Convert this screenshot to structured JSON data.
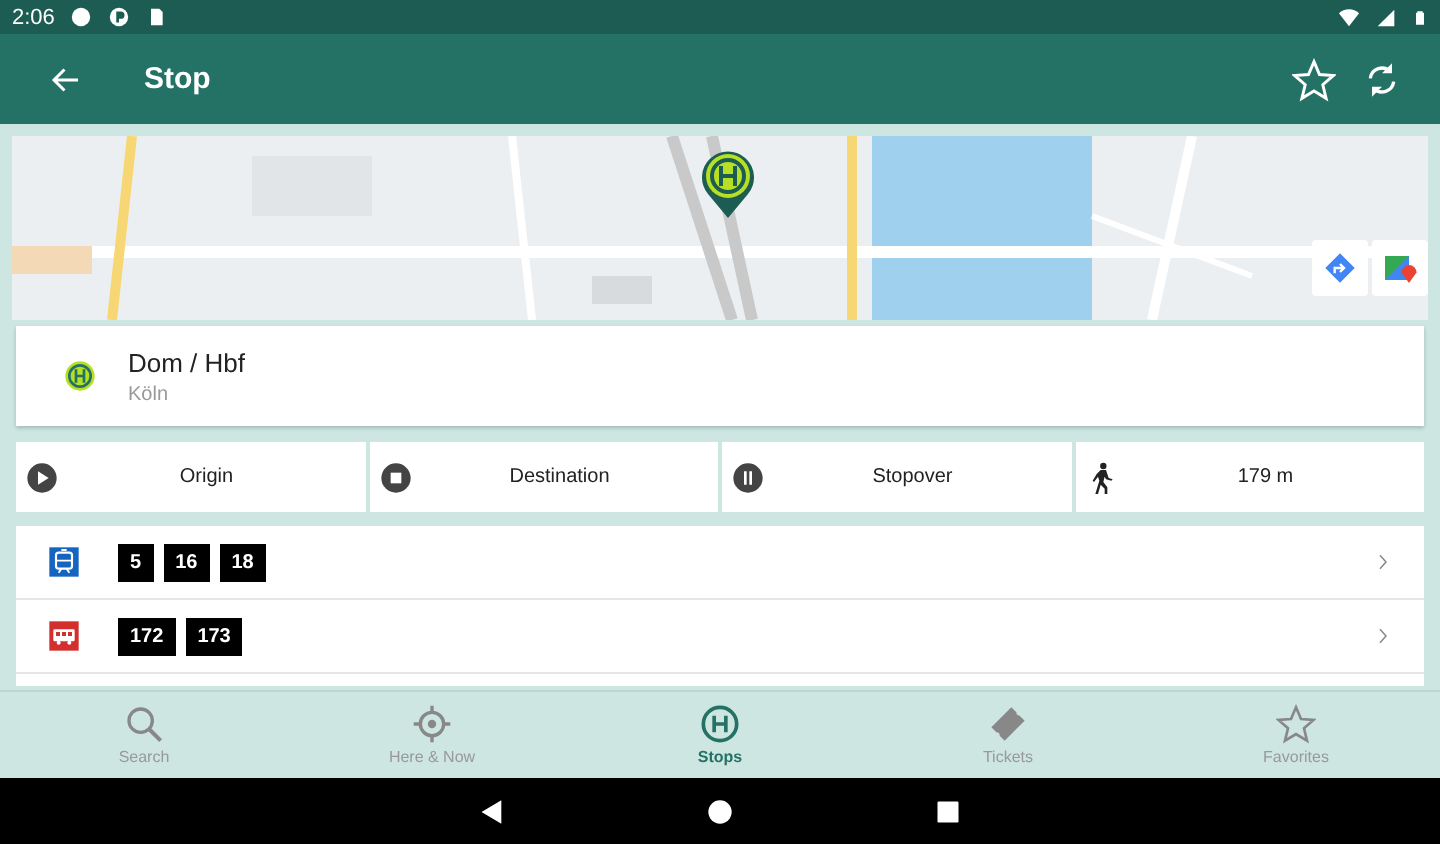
{
  "status_bar": {
    "time": "2:06"
  },
  "toolbar": {
    "title": "Stop"
  },
  "stop": {
    "name": "Dom / Hbf",
    "place": "Köln"
  },
  "actions": [
    {
      "kind": "origin",
      "label": "Origin"
    },
    {
      "kind": "destination",
      "label": "Destination"
    },
    {
      "kind": "stopover",
      "label": "Stopover"
    },
    {
      "kind": "walk",
      "label": "179 m"
    }
  ],
  "lines": [
    {
      "kind": "tram",
      "numbers": [
        "5",
        "16",
        "18"
      ]
    },
    {
      "kind": "bus",
      "numbers": [
        "172",
        "173"
      ]
    }
  ],
  "bottom_nav": [
    {
      "kind": "search",
      "label": "Search",
      "selected": false
    },
    {
      "kind": "location",
      "label": "Here & Now",
      "selected": false
    },
    {
      "kind": "stops",
      "label": "Stops",
      "selected": true
    },
    {
      "kind": "tickets",
      "label": "Tickets",
      "selected": false
    },
    {
      "kind": "favorites",
      "label": "Favorites",
      "selected": false
    }
  ]
}
